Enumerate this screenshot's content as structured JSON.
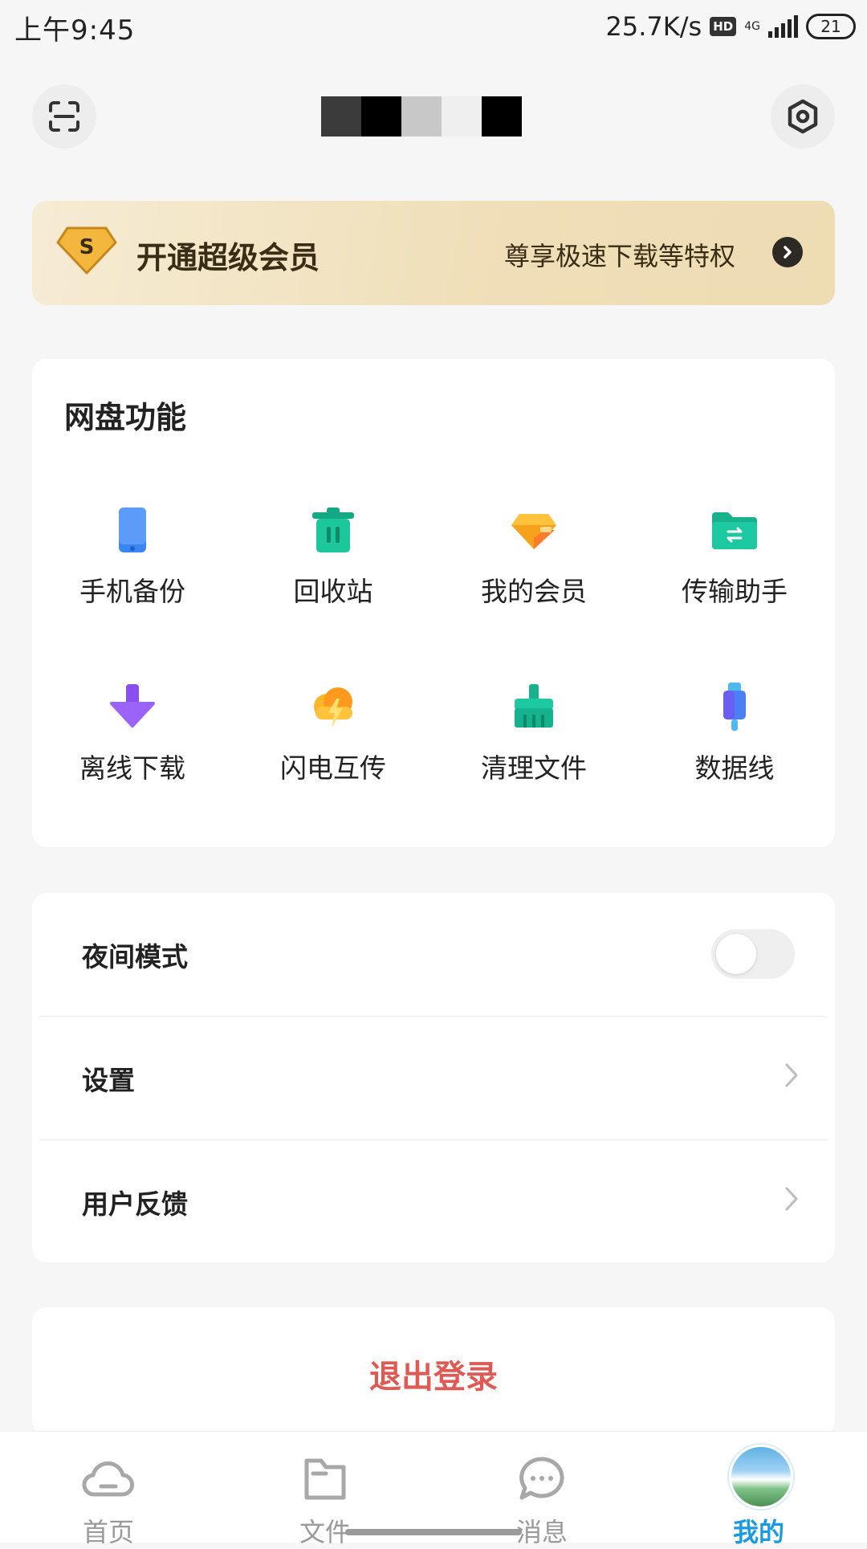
{
  "status_bar": {
    "time": "上午9:45",
    "speed": "25.7K/s",
    "hd": "HD",
    "network": "4G",
    "battery": "21"
  },
  "header": {
    "scan_icon": "scan-icon",
    "settings_icon": "hexagon-settings-icon"
  },
  "vip_banner": {
    "badge": "S",
    "title": "开通超级会员",
    "subtitle": "尊享极速下载等特权"
  },
  "features": {
    "title": "网盘功能",
    "items": [
      {
        "label": "手机备份",
        "icon": "phone-backup-icon",
        "color": "#3a86f5"
      },
      {
        "label": "回收站",
        "icon": "trash-icon",
        "color": "#19c39a"
      },
      {
        "label": "我的会员",
        "icon": "diamond-icon",
        "color": "#f7a21b"
      },
      {
        "label": "传输助手",
        "icon": "transfer-folder-icon",
        "color": "#19c39a"
      },
      {
        "label": "离线下载",
        "icon": "download-arrow-icon",
        "color": "#8a4ff0"
      },
      {
        "label": "闪电互传",
        "icon": "lightning-cloud-icon",
        "color": "#f7a21b"
      },
      {
        "label": "清理文件",
        "icon": "broom-icon",
        "color": "#19c39a"
      },
      {
        "label": "数据线",
        "icon": "usb-cable-icon",
        "color": "#4a7ff5"
      }
    ]
  },
  "settings_list": {
    "night_mode": {
      "label": "夜间模式",
      "enabled": false
    },
    "settings": {
      "label": "设置"
    },
    "feedback": {
      "label": "用户反馈"
    }
  },
  "logout": {
    "label": "退出登录"
  },
  "tabbar": {
    "tabs": [
      {
        "label": "首页",
        "icon": "cloud-icon"
      },
      {
        "label": "文件",
        "icon": "folder-icon"
      },
      {
        "label": "消息",
        "icon": "chat-bubble-icon"
      },
      {
        "label": "我的",
        "icon": "avatar",
        "active": true
      }
    ]
  }
}
